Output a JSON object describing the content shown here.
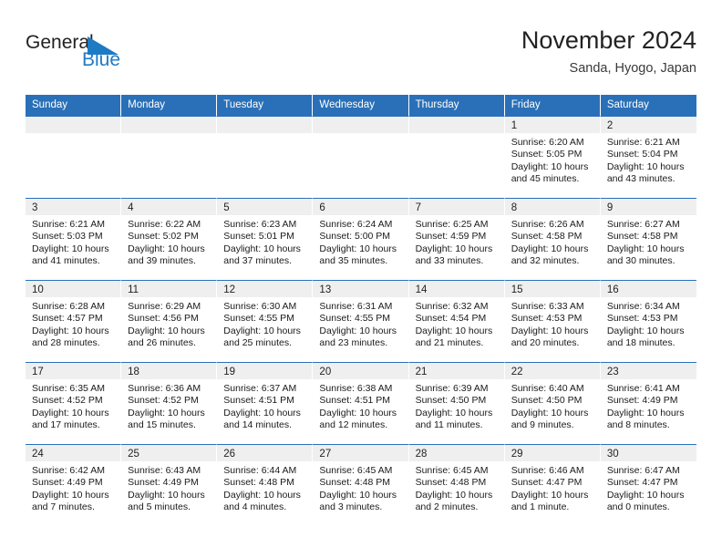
{
  "logo": {
    "word_one": "General",
    "word_two": "Blue",
    "triangle_color": "#1f7ac4"
  },
  "header": {
    "title": "November 2024",
    "subtitle": "Sanda, Hyogo, Japan"
  },
  "colors": {
    "header_blue": "#2a70b8",
    "daynum_band": "#efefef",
    "text": "#1a1a1a"
  },
  "weekday_headers": [
    "Sunday",
    "Monday",
    "Tuesday",
    "Wednesday",
    "Thursday",
    "Friday",
    "Saturday"
  ],
  "weeks": [
    [
      {
        "day": "",
        "empty": true
      },
      {
        "day": "",
        "empty": true
      },
      {
        "day": "",
        "empty": true
      },
      {
        "day": "",
        "empty": true
      },
      {
        "day": "",
        "empty": true
      },
      {
        "day": "1",
        "sunrise": "Sunrise: 6:20 AM",
        "sunset": "Sunset: 5:05 PM",
        "daylight": "Daylight: 10 hours and 45 minutes."
      },
      {
        "day": "2",
        "sunrise": "Sunrise: 6:21 AM",
        "sunset": "Sunset: 5:04 PM",
        "daylight": "Daylight: 10 hours and 43 minutes."
      }
    ],
    [
      {
        "day": "3",
        "sunrise": "Sunrise: 6:21 AM",
        "sunset": "Sunset: 5:03 PM",
        "daylight": "Daylight: 10 hours and 41 minutes."
      },
      {
        "day": "4",
        "sunrise": "Sunrise: 6:22 AM",
        "sunset": "Sunset: 5:02 PM",
        "daylight": "Daylight: 10 hours and 39 minutes."
      },
      {
        "day": "5",
        "sunrise": "Sunrise: 6:23 AM",
        "sunset": "Sunset: 5:01 PM",
        "daylight": "Daylight: 10 hours and 37 minutes."
      },
      {
        "day": "6",
        "sunrise": "Sunrise: 6:24 AM",
        "sunset": "Sunset: 5:00 PM",
        "daylight": "Daylight: 10 hours and 35 minutes."
      },
      {
        "day": "7",
        "sunrise": "Sunrise: 6:25 AM",
        "sunset": "Sunset: 4:59 PM",
        "daylight": "Daylight: 10 hours and 33 minutes."
      },
      {
        "day": "8",
        "sunrise": "Sunrise: 6:26 AM",
        "sunset": "Sunset: 4:58 PM",
        "daylight": "Daylight: 10 hours and 32 minutes."
      },
      {
        "day": "9",
        "sunrise": "Sunrise: 6:27 AM",
        "sunset": "Sunset: 4:58 PM",
        "daylight": "Daylight: 10 hours and 30 minutes."
      }
    ],
    [
      {
        "day": "10",
        "sunrise": "Sunrise: 6:28 AM",
        "sunset": "Sunset: 4:57 PM",
        "daylight": "Daylight: 10 hours and 28 minutes."
      },
      {
        "day": "11",
        "sunrise": "Sunrise: 6:29 AM",
        "sunset": "Sunset: 4:56 PM",
        "daylight": "Daylight: 10 hours and 26 minutes."
      },
      {
        "day": "12",
        "sunrise": "Sunrise: 6:30 AM",
        "sunset": "Sunset: 4:55 PM",
        "daylight": "Daylight: 10 hours and 25 minutes."
      },
      {
        "day": "13",
        "sunrise": "Sunrise: 6:31 AM",
        "sunset": "Sunset: 4:55 PM",
        "daylight": "Daylight: 10 hours and 23 minutes."
      },
      {
        "day": "14",
        "sunrise": "Sunrise: 6:32 AM",
        "sunset": "Sunset: 4:54 PM",
        "daylight": "Daylight: 10 hours and 21 minutes."
      },
      {
        "day": "15",
        "sunrise": "Sunrise: 6:33 AM",
        "sunset": "Sunset: 4:53 PM",
        "daylight": "Daylight: 10 hours and 20 minutes."
      },
      {
        "day": "16",
        "sunrise": "Sunrise: 6:34 AM",
        "sunset": "Sunset: 4:53 PM",
        "daylight": "Daylight: 10 hours and 18 minutes."
      }
    ],
    [
      {
        "day": "17",
        "sunrise": "Sunrise: 6:35 AM",
        "sunset": "Sunset: 4:52 PM",
        "daylight": "Daylight: 10 hours and 17 minutes."
      },
      {
        "day": "18",
        "sunrise": "Sunrise: 6:36 AM",
        "sunset": "Sunset: 4:52 PM",
        "daylight": "Daylight: 10 hours and 15 minutes."
      },
      {
        "day": "19",
        "sunrise": "Sunrise: 6:37 AM",
        "sunset": "Sunset: 4:51 PM",
        "daylight": "Daylight: 10 hours and 14 minutes."
      },
      {
        "day": "20",
        "sunrise": "Sunrise: 6:38 AM",
        "sunset": "Sunset: 4:51 PM",
        "daylight": "Daylight: 10 hours and 12 minutes."
      },
      {
        "day": "21",
        "sunrise": "Sunrise: 6:39 AM",
        "sunset": "Sunset: 4:50 PM",
        "daylight": "Daylight: 10 hours and 11 minutes."
      },
      {
        "day": "22",
        "sunrise": "Sunrise: 6:40 AM",
        "sunset": "Sunset: 4:50 PM",
        "daylight": "Daylight: 10 hours and 9 minutes."
      },
      {
        "day": "23",
        "sunrise": "Sunrise: 6:41 AM",
        "sunset": "Sunset: 4:49 PM",
        "daylight": "Daylight: 10 hours and 8 minutes."
      }
    ],
    [
      {
        "day": "24",
        "sunrise": "Sunrise: 6:42 AM",
        "sunset": "Sunset: 4:49 PM",
        "daylight": "Daylight: 10 hours and 7 minutes."
      },
      {
        "day": "25",
        "sunrise": "Sunrise: 6:43 AM",
        "sunset": "Sunset: 4:49 PM",
        "daylight": "Daylight: 10 hours and 5 minutes."
      },
      {
        "day": "26",
        "sunrise": "Sunrise: 6:44 AM",
        "sunset": "Sunset: 4:48 PM",
        "daylight": "Daylight: 10 hours and 4 minutes."
      },
      {
        "day": "27",
        "sunrise": "Sunrise: 6:45 AM",
        "sunset": "Sunset: 4:48 PM",
        "daylight": "Daylight: 10 hours and 3 minutes."
      },
      {
        "day": "28",
        "sunrise": "Sunrise: 6:45 AM",
        "sunset": "Sunset: 4:48 PM",
        "daylight": "Daylight: 10 hours and 2 minutes."
      },
      {
        "day": "29",
        "sunrise": "Sunrise: 6:46 AM",
        "sunset": "Sunset: 4:47 PM",
        "daylight": "Daylight: 10 hours and 1 minute."
      },
      {
        "day": "30",
        "sunrise": "Sunrise: 6:47 AM",
        "sunset": "Sunset: 4:47 PM",
        "daylight": "Daylight: 10 hours and 0 minutes."
      }
    ]
  ]
}
